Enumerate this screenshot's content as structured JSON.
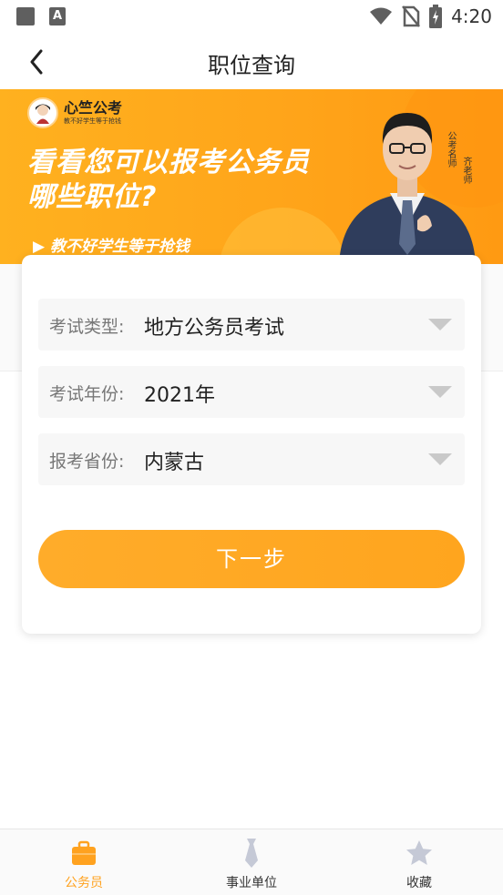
{
  "status_bar": {
    "time": "4:20"
  },
  "header": {
    "title": "职位查询"
  },
  "banner": {
    "logo_name": "心竺公考",
    "logo_slogan": "教不好学生等于抢钱",
    "headline_line1": "看看您可以报考公务员",
    "headline_line2": "哪些职位?",
    "subline": "▶ 教不好学生等于抢钱",
    "teacher_tag": "公考名师",
    "teacher_name": "齐老师"
  },
  "form": {
    "exam_type": {
      "label": "考试类型:",
      "value": "地方公务员考试"
    },
    "exam_year": {
      "label": "考试年份:",
      "value": "2021年"
    },
    "province": {
      "label": "报考省份:",
      "value": "内蒙古"
    },
    "next_label": "下一步"
  },
  "bottom_nav": {
    "items": [
      {
        "label": "公务员",
        "icon": "briefcase-icon",
        "active": true
      },
      {
        "label": "事业单位",
        "icon": "tie-icon",
        "active": false
      },
      {
        "label": "收藏",
        "icon": "star-icon",
        "active": false
      }
    ],
    "active_color": "#ffa21f",
    "inactive_icon_color": "#c5c9d6"
  },
  "colors": {
    "accent": "#ffa51e",
    "banner": "#ffb11f"
  }
}
